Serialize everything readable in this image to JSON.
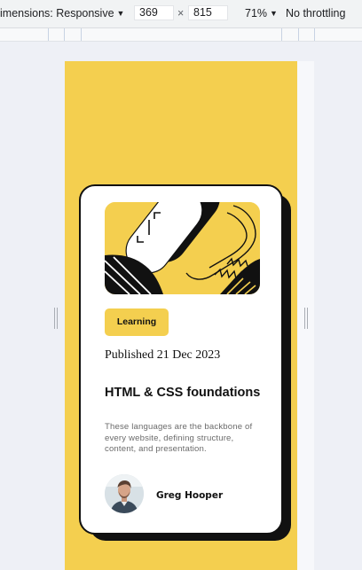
{
  "devtools": {
    "dimensions_label": "imensions: Responsive",
    "width_value": "369",
    "height_value": "815",
    "times": "×",
    "zoom": "71%",
    "throttling": "No throttling"
  },
  "card": {
    "badge": "Learning",
    "published": "Published 21 Dec 2023",
    "title": "HTML & CSS foundations",
    "description": "These languages are the backbone of every website, defining structure, content, and presentation.",
    "author": "Greg Hooper",
    "illustration_icon": "abstract-illustration",
    "avatar_icon": "avatar-photo"
  },
  "colors": {
    "accent": "#f4cf4f",
    "ink": "#111111",
    "muted": "#6b6b6b"
  }
}
